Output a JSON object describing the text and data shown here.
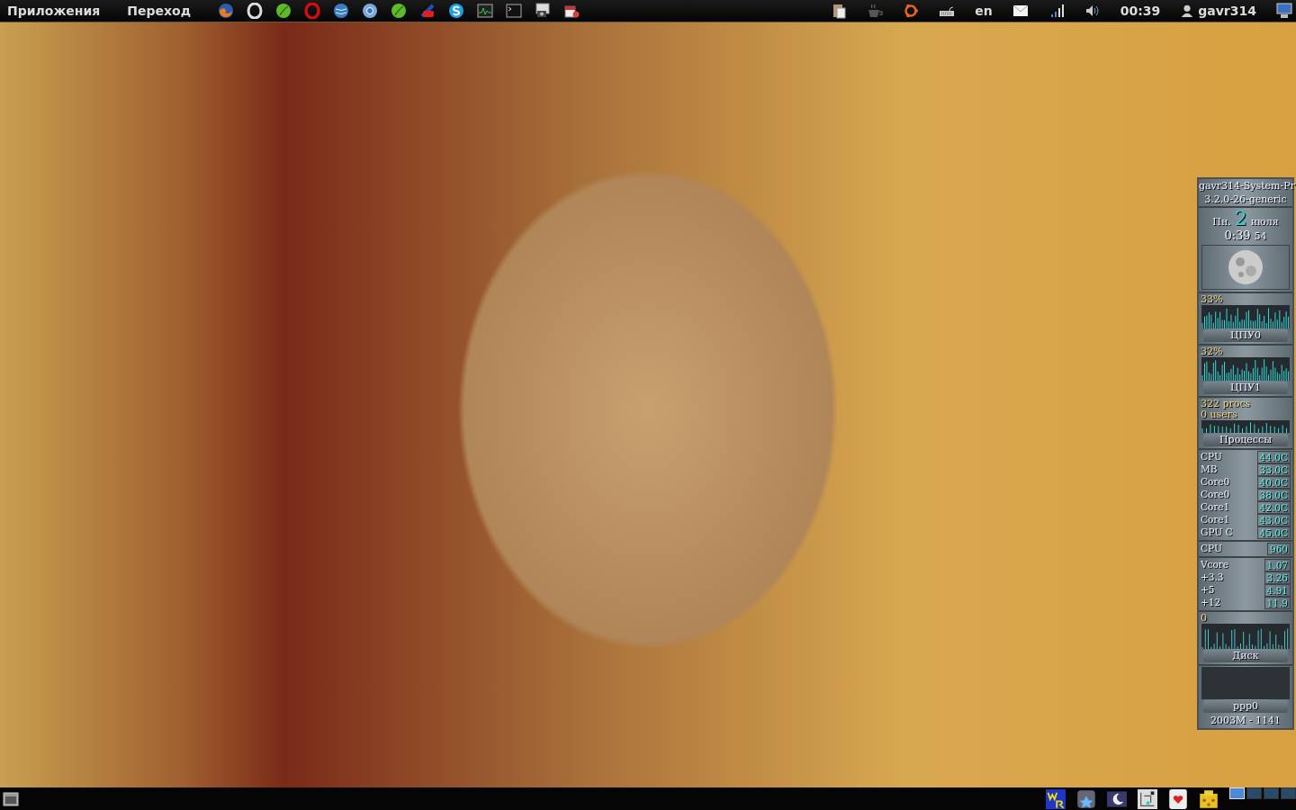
{
  "top_panel": {
    "menus": [
      "Приложения",
      "Переход"
    ],
    "launchers": [
      {
        "kind": "firefox"
      },
      {
        "kind": "ring"
      },
      {
        "kind": "leaf"
      },
      {
        "kind": "opera"
      },
      {
        "kind": "globe"
      },
      {
        "kind": "chromium"
      },
      {
        "kind": "leaf"
      },
      {
        "kind": "plus"
      },
      {
        "kind": "skype"
      },
      {
        "kind": "monitor"
      },
      {
        "kind": "terminal"
      },
      {
        "kind": "camera"
      },
      {
        "kind": "package"
      }
    ],
    "tray": [
      {
        "kind": "clipboard"
      },
      {
        "kind": "cup"
      },
      {
        "kind": "ubuntu"
      },
      {
        "kind": "keyboard"
      },
      {
        "kind": "text",
        "text": "en"
      },
      {
        "kind": "mail"
      },
      {
        "kind": "signal"
      },
      {
        "kind": "volume"
      },
      {
        "kind": "text",
        "text": "00:39"
      },
      {
        "kind": "user",
        "text": "gavr314"
      },
      {
        "kind": "computer"
      }
    ]
  },
  "system_monitor": {
    "hostname": "gavr314-System-Pr",
    "kernel": "3.2.0-26-generic",
    "weekday": "Пн.",
    "day": "2",
    "month": "июля",
    "time": "0:39",
    "seconds": "54",
    "cpus": [
      {
        "percent": "33%",
        "label": "ЦПУ0"
      },
      {
        "percent": "32%",
        "label": "ЦПУ1"
      }
    ],
    "processes": {
      "procs": "322 procs",
      "users": "0 users",
      "label": "Процессы"
    },
    "sensors": [
      {
        "name": "CPU",
        "value": "44.0C"
      },
      {
        "name": "MB",
        "value": "33.0C"
      },
      {
        "name": "Core0",
        "value": "40.0C"
      },
      {
        "name": "Core0",
        "value": "38.0C"
      },
      {
        "name": "Core1",
        "value": "42.0C"
      },
      {
        "name": "Core1",
        "value": "43.0C"
      },
      {
        "name": "GPU C",
        "value": "45.0C"
      }
    ],
    "fan": {
      "name": "CPU",
      "value": "960"
    },
    "voltages": [
      {
        "name": "Vcore",
        "value": "1.07"
      },
      {
        "name": "+3.3",
        "value": "3.26"
      },
      {
        "name": "+5",
        "value": "4.91"
      },
      {
        "name": "+12",
        "value": "11.9"
      }
    ],
    "disk": {
      "reading": "0",
      "label": "Диск"
    },
    "network": {
      "label": "ppp0",
      "traffic": "2003M - 1141"
    }
  },
  "bottom_panel": {
    "items": [
      {
        "kind": "show-desktop"
      },
      {
        "kind": "wr"
      },
      {
        "kind": "stars"
      },
      {
        "kind": "moon"
      },
      {
        "kind": "diagram"
      },
      {
        "kind": "cards"
      },
      {
        "kind": "mahjong"
      }
    ],
    "workspaces": [
      {
        "selected": true
      },
      {
        "selected": false
      },
      {
        "selected": false
      },
      {
        "selected": false
      }
    ]
  }
}
